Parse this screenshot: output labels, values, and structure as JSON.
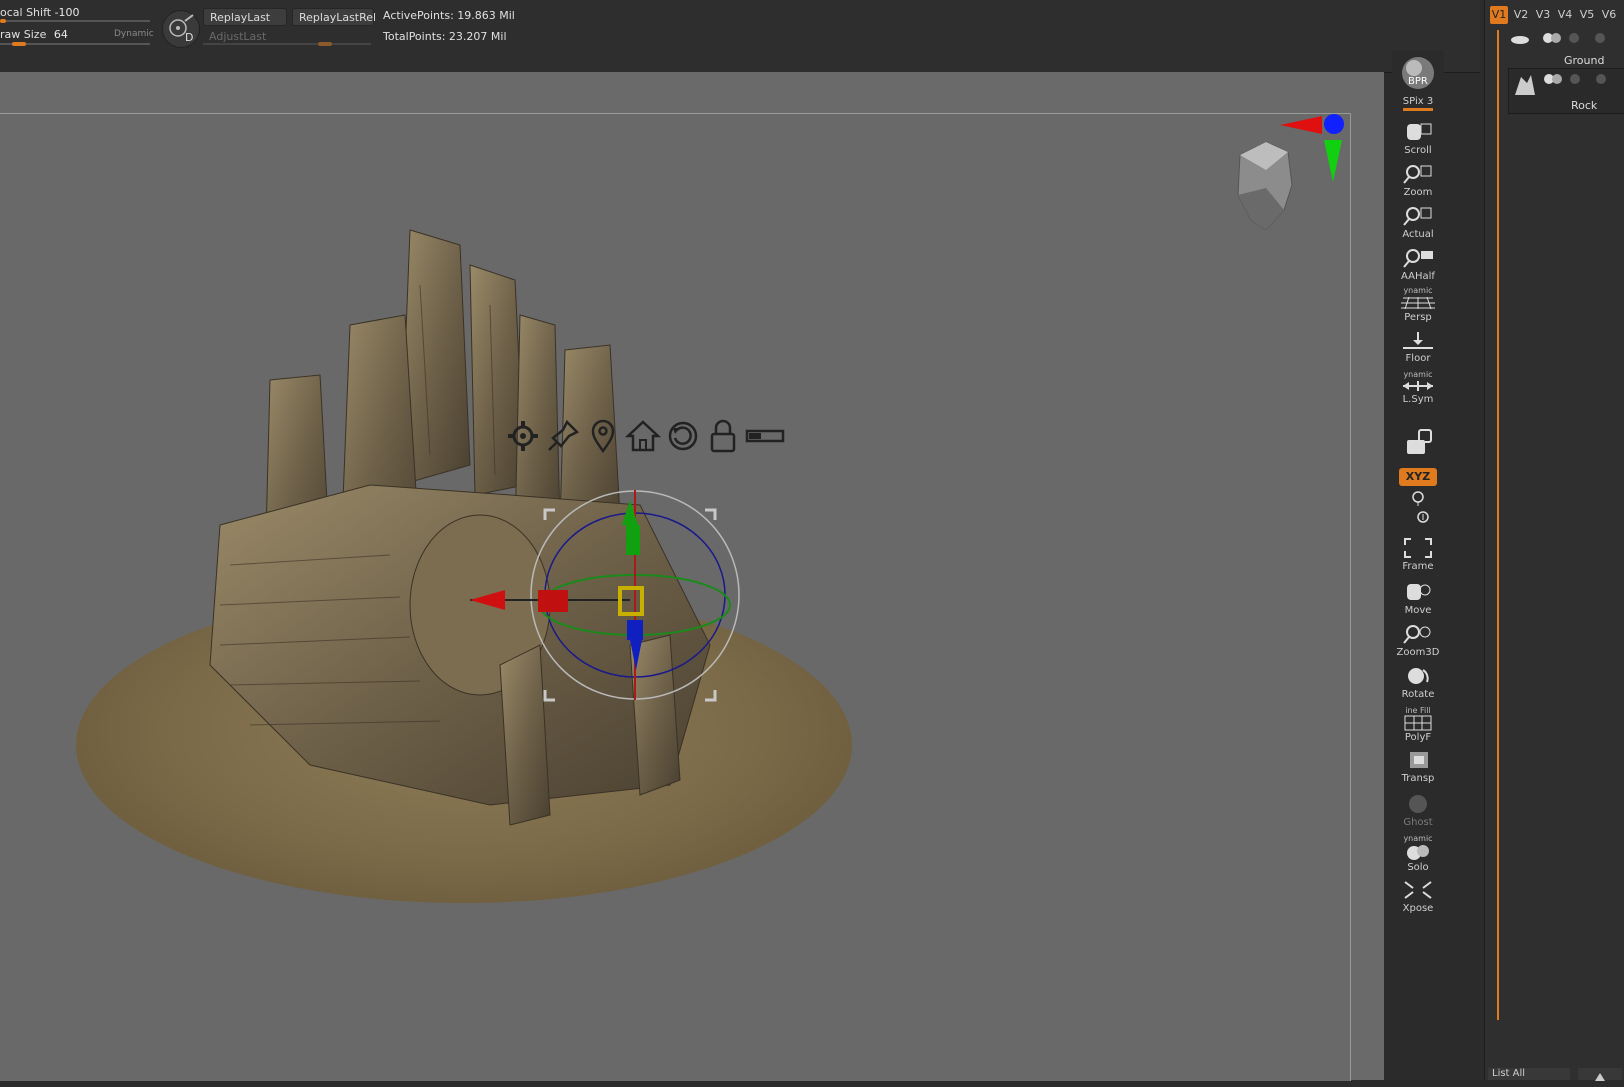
{
  "topbar": {
    "focal_shift_label": "ocal Shift",
    "focal_shift_value": "-100",
    "draw_size_label": "raw Size",
    "draw_size_value": "64",
    "dynamic_label": "Dynamic",
    "circle_button_letter": "D",
    "replay_last": "ReplayLast",
    "replay_last_rel": "ReplayLastRel",
    "adjust_last": "AdjustLast",
    "active_points": "ActivePoints: 19.863 Mil",
    "total_points": "TotalPoints: 23.207 Mil"
  },
  "right_shelf": {
    "bpr": "BPR",
    "spix": "SPix 3",
    "scroll": "Scroll",
    "zoom": "Zoom",
    "actual": "Actual",
    "aahalf": "AAHalf",
    "dynamic_persp": "ynamic",
    "persp": "Persp",
    "floor": "Floor",
    "dynamic_lsym": "ynamic",
    "lsym": "L.Sym",
    "xyz": "XYZ",
    "frame": "Frame",
    "move": "Move",
    "zoom3d": "Zoom3D",
    "rotate": "Rotate",
    "line_fill": "ine Fill",
    "polyf": "PolyF",
    "transp": "Transp",
    "ghost": "Ghost",
    "dynamic_solo": "ynamic",
    "solo": "Solo",
    "xpose": "Xpose"
  },
  "subtool_panel": {
    "tabs": [
      "V1",
      "V2",
      "V3",
      "V4",
      "V5",
      "V6"
    ],
    "active_tab": "V1",
    "items": [
      {
        "label": "Ground"
      },
      {
        "label": "Rock"
      }
    ],
    "list_all": "List All"
  },
  "colors": {
    "accent": "#e07a1f",
    "canvas": "#696969",
    "x_axis": "#e01010",
    "y_axis": "#10c010",
    "z_axis": "#1020e0"
  },
  "icons": [
    "gear-icon",
    "pin-icon",
    "location-pin-icon",
    "home-icon",
    "reset-icon",
    "lock-icon",
    "toggle-icon"
  ]
}
